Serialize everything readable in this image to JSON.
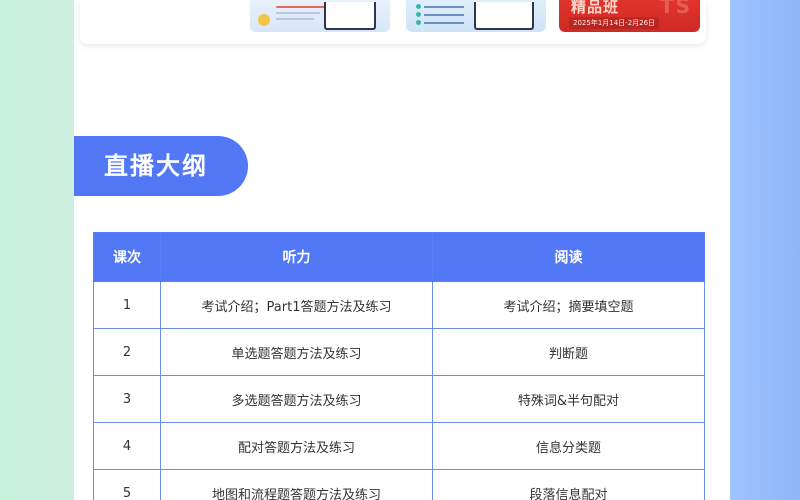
{
  "promo": {
    "title": "精品班",
    "bg_text": "TS",
    "date": "2025年1月14日-2月26日"
  },
  "section": {
    "title": "直播大纲"
  },
  "table": {
    "headers": [
      "课次",
      "听力",
      "阅读"
    ],
    "rows": [
      {
        "no": "1",
        "listening": "考试介绍；Part1答题方法及练习",
        "reading": "考试介绍；摘要填空题"
      },
      {
        "no": "2",
        "listening": "单选题答题方法及练习",
        "reading": "判断题"
      },
      {
        "no": "3",
        "listening": "多选题答题方法及练习",
        "reading": "特殊词&半句配对"
      },
      {
        "no": "4",
        "listening": "配对答题方法及练习",
        "reading": "信息分类题"
      },
      {
        "no": "5",
        "listening": "地图和流程题答题方法及练习",
        "reading": "段落信息配对"
      }
    ]
  },
  "colors": {
    "accent": "#5278f6",
    "left_bg": "#c8f2dc",
    "right_bg": "#9fc2fb",
    "promo_red": "#e0342c"
  }
}
